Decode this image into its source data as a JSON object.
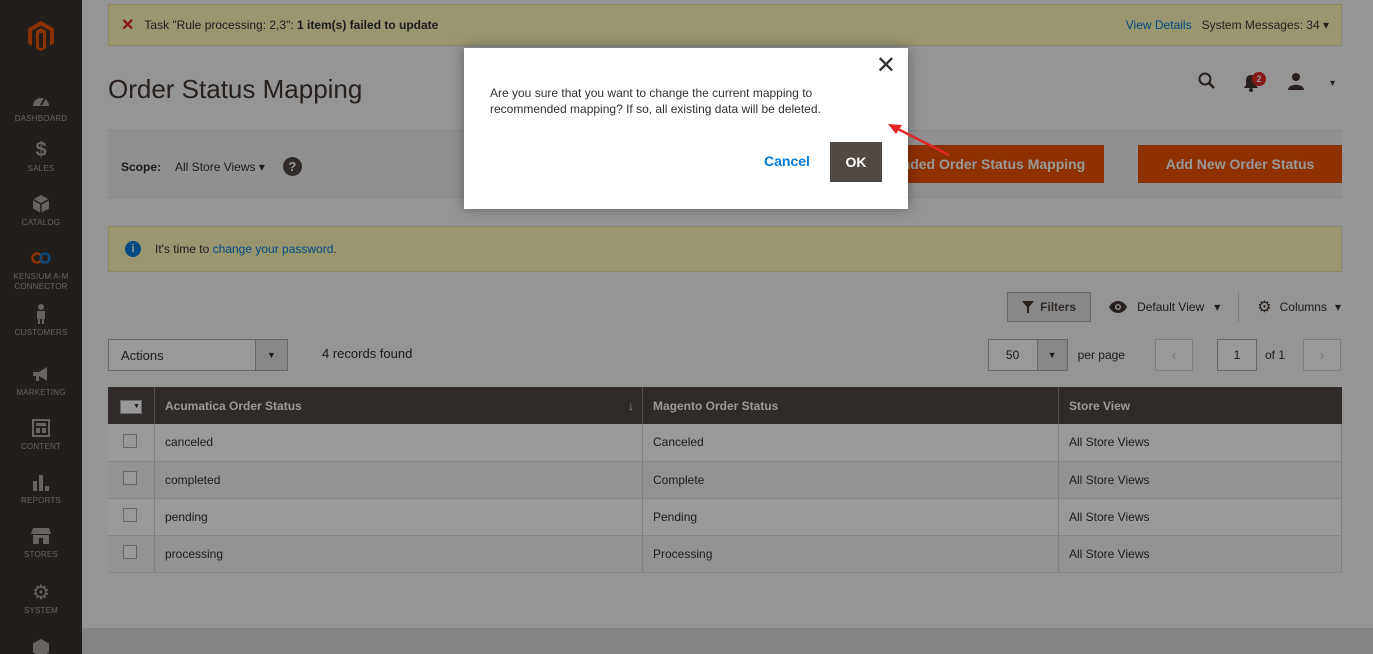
{
  "sidebar": {
    "items": [
      {
        "label": "DASHBOARD",
        "icon": "dashboard-icon"
      },
      {
        "label": "SALES",
        "icon": "dollar-icon"
      },
      {
        "label": "CATALOG",
        "icon": "cube-icon"
      },
      {
        "label": "KENSIUM A-M CONNECTOR",
        "icon": "connector-icon"
      },
      {
        "label": "CUSTOMERS",
        "icon": "person-icon"
      },
      {
        "label": "MARKETING",
        "icon": "megaphone-icon"
      },
      {
        "label": "CONTENT",
        "icon": "layout-icon"
      },
      {
        "label": "REPORTS",
        "icon": "bar-chart-icon"
      },
      {
        "label": "STORES",
        "icon": "store-icon"
      },
      {
        "label": "SYSTEM",
        "icon": "gear-icon"
      }
    ]
  },
  "system_message": {
    "prefix": "Task \"Rule processing: 2,3\": ",
    "bold": "1 item(s) failed to update",
    "view_details": "View Details",
    "system_messages": "System Messages: 34"
  },
  "page": {
    "title": "Order Status Mapping",
    "notification_count": "2"
  },
  "scope": {
    "label": "Scope:",
    "value": "All Store Views",
    "help": "?"
  },
  "buttons": {
    "recommended": "Recommended Order Status Mapping",
    "add_new": "Add New Order Status"
  },
  "notice": {
    "prefix": "It's time to ",
    "link": "change your password",
    "suffix": "."
  },
  "grid_toolbar": {
    "filters": "Filters",
    "default_view": "Default View",
    "columns": "Columns",
    "actions": "Actions",
    "records_found": "4 records found",
    "per_page_value": "50",
    "per_page_label": "per page",
    "current_page": "1",
    "of_pages": "of 1"
  },
  "table": {
    "headers": [
      "Acumatica Order Status",
      "Magento Order Status",
      "Store View"
    ],
    "rows": [
      [
        "canceled",
        "Canceled",
        "All Store Views"
      ],
      [
        "completed",
        "Complete",
        "All Store Views"
      ],
      [
        "pending",
        "Pending",
        "All Store Views"
      ],
      [
        "processing",
        "Processing",
        "All Store Views"
      ]
    ]
  },
  "modal": {
    "message": "Are you sure that you want to change the current mapping to recommended mapping? If so, all existing data will be deleted.",
    "cancel": "Cancel",
    "ok": "OK"
  },
  "colors": {
    "sidebar": "#373330",
    "accent_orange": "#eb5202",
    "header_dark": "#514943",
    "link_blue": "#007bdb",
    "notice_yellow": "#fffbbb"
  }
}
